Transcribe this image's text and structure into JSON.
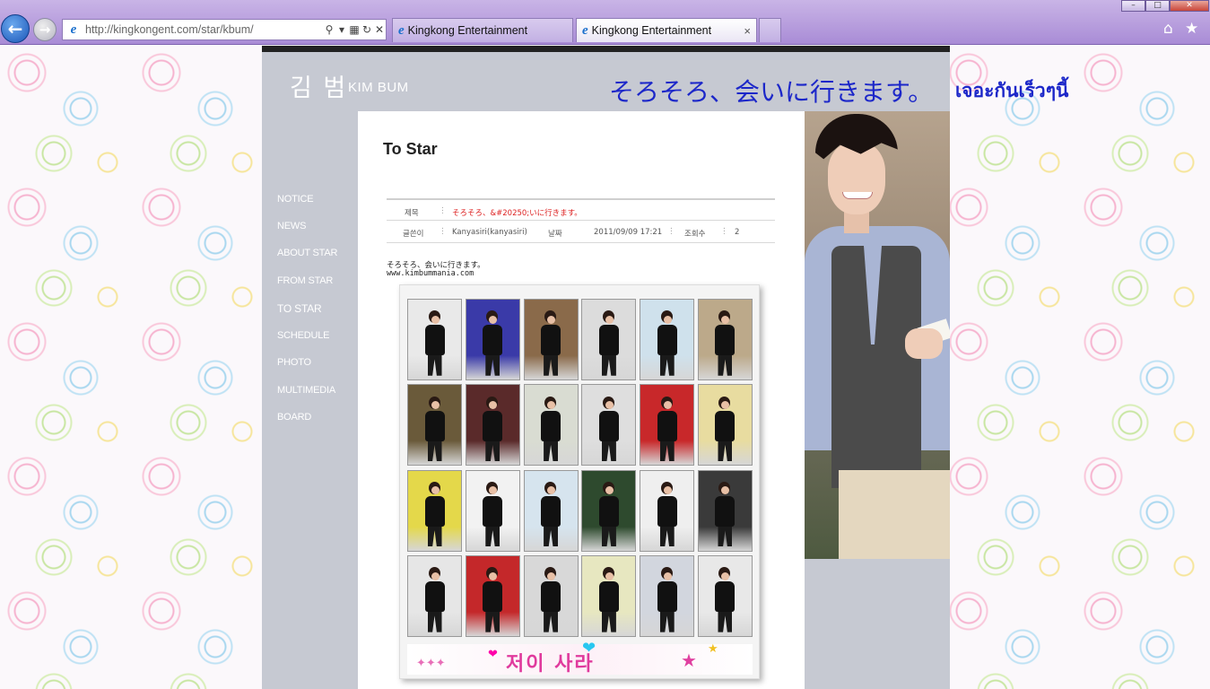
{
  "browser": {
    "url": "http://kingkongent.com/star/kbum/",
    "address_icons": [
      "search-icon",
      "dropdown-icon",
      "compat-icon",
      "refresh-icon",
      "stop-icon"
    ],
    "tabs": [
      {
        "label": "Kingkong Entertainment",
        "active": false
      },
      {
        "label": "Kingkong Entertainment",
        "active": true
      }
    ],
    "tab_close": "×",
    "window_controls": [
      "minimize",
      "maximize",
      "close"
    ]
  },
  "site": {
    "logo_korean": "김 범",
    "logo_english": "KIM BUM",
    "headline_japanese": "そろそろ、会いに行きます。",
    "headline_thai": "เจอะกันเร็วๆนี้",
    "menu": [
      {
        "label": "NOTICE"
      },
      {
        "label": "NEWS"
      },
      {
        "label": "ABOUT STAR"
      },
      {
        "label": "FROM STAR"
      },
      {
        "label": "TO STAR",
        "active": true
      },
      {
        "label": "SCHEDULE"
      },
      {
        "label": "PHOTO"
      },
      {
        "label": "MULTIMEDIA"
      },
      {
        "label": "BOARD"
      }
    ]
  },
  "post": {
    "page_title": "To Star",
    "subject_label": "제목",
    "subject": "そろそろ、&#20250;いに行きます。",
    "author_label": "글쓴이",
    "author": "Kanyasiri(kanyasiri)",
    "date_label": "날짜",
    "date": "2011/09/09 17:21",
    "views_label": "조회수",
    "views": "2",
    "body_line1": "そろそろ、会いに行きます。",
    "body_line2": "www.kimbummania.com",
    "banner_text": "저이 사라"
  },
  "colors": {
    "accent_blue": "#1c27c9",
    "site_gray": "#c6c9d2",
    "subject_red": "#d22222",
    "chrome_purple": "#b49be0"
  }
}
